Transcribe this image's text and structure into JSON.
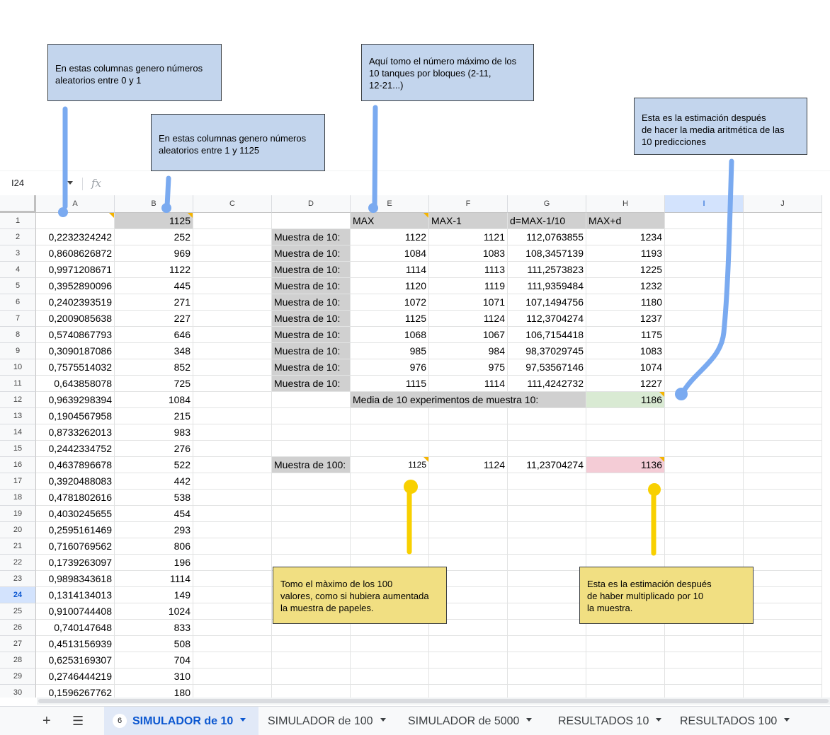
{
  "formula_bar": {
    "cell_ref": "I24",
    "fx_symbol": "fx"
  },
  "columns": [
    "A",
    "B",
    "C",
    "D",
    "E",
    "F",
    "G",
    "H",
    "I",
    "J"
  ],
  "selected_column": "I",
  "selected_row": "24",
  "rows": [
    {
      "n": "1",
      "a": "",
      "b": "1125",
      "d": "",
      "e": "MAX",
      "f": "MAX-1",
      "g": "d=MAX-1/10",
      "h": "MAX+d"
    },
    {
      "n": "2",
      "a": "0,2232324242",
      "b": "252",
      "d": "Muestra de 10:",
      "e": "1122",
      "f": "1121",
      "g": "112,0763855",
      "h": "1234"
    },
    {
      "n": "3",
      "a": "0,8608626872",
      "b": "969",
      "d": "Muestra de 10:",
      "e": "1084",
      "f": "1083",
      "g": "108,3457139",
      "h": "1193"
    },
    {
      "n": "4",
      "a": "0,9971208671",
      "b": "1122",
      "d": "Muestra de 10:",
      "e": "1114",
      "f": "1113",
      "g": "111,2573823",
      "h": "1225"
    },
    {
      "n": "5",
      "a": "0,3952890096",
      "b": "445",
      "d": "Muestra de 10:",
      "e": "1120",
      "f": "1119",
      "g": "111,9359484",
      "h": "1232"
    },
    {
      "n": "6",
      "a": "0,2402393519",
      "b": "271",
      "d": "Muestra de 10:",
      "e": "1072",
      "f": "1071",
      "g": "107,1494756",
      "h": "1180"
    },
    {
      "n": "7",
      "a": "0,2009085638",
      "b": "227",
      "d": "Muestra de 10:",
      "e": "1125",
      "f": "1124",
      "g": "112,3704274",
      "h": "1237"
    },
    {
      "n": "8",
      "a": "0,5740867793",
      "b": "646",
      "d": "Muestra de 10:",
      "e": "1068",
      "f": "1067",
      "g": "106,7154418",
      "h": "1175"
    },
    {
      "n": "9",
      "a": "0,3090187086",
      "b": "348",
      "d": "Muestra de 10:",
      "e": "985",
      "f": "984",
      "g": "98,37029745",
      "h": "1083"
    },
    {
      "n": "10",
      "a": "0,7575514032",
      "b": "852",
      "d": "Muestra de 10:",
      "e": "976",
      "f": "975",
      "g": "97,53567146",
      "h": "1074"
    },
    {
      "n": "11",
      "a": "0,643858078",
      "b": "725",
      "d": "Muestra de 10:",
      "e": "1115",
      "f": "1114",
      "g": "111,4242732",
      "h": "1227"
    },
    {
      "n": "12",
      "a": "0,9639298394",
      "b": "1084",
      "d": "",
      "e": "Media de 10 experimentos de muestra 10:",
      "f": "",
      "g": "",
      "h": "1186"
    },
    {
      "n": "13",
      "a": "0,1904567958",
      "b": "215",
      "d": "",
      "e": "",
      "f": "",
      "g": "",
      "h": ""
    },
    {
      "n": "14",
      "a": "0,8733262013",
      "b": "983",
      "d": "",
      "e": "",
      "f": "",
      "g": "",
      "h": ""
    },
    {
      "n": "15",
      "a": "0,2442334752",
      "b": "276",
      "d": "",
      "e": "",
      "f": "",
      "g": "",
      "h": ""
    },
    {
      "n": "16",
      "a": "0,4637896678",
      "b": "522",
      "d": "Muestra de 100:",
      "e": "1125",
      "f": "1124",
      "g": "11,23704274",
      "h": "1136"
    },
    {
      "n": "17",
      "a": "0,3920488083",
      "b": "442"
    },
    {
      "n": "18",
      "a": "0,4781802616",
      "b": "538"
    },
    {
      "n": "19",
      "a": "0,4030245655",
      "b": "454"
    },
    {
      "n": "20",
      "a": "0,2595161469",
      "b": "293"
    },
    {
      "n": "21",
      "a": "0,7160769562",
      "b": "806"
    },
    {
      "n": "22",
      "a": "0,1739263097",
      "b": "196"
    },
    {
      "n": "23",
      "a": "0,9898343618",
      "b": "1114"
    },
    {
      "n": "24",
      "a": "0,1314134013",
      "b": "149"
    },
    {
      "n": "25",
      "a": "0,9100744408",
      "b": "1024"
    },
    {
      "n": "26",
      "a": "0,740147648",
      "b": "833"
    },
    {
      "n": "27",
      "a": "0,4513156939",
      "b": "508"
    },
    {
      "n": "28",
      "a": "0,6253169307",
      "b": "704"
    },
    {
      "n": "29",
      "a": "0,2746444219",
      "b": "310"
    },
    {
      "n": "30",
      "a": "0,1596267762",
      "b": "180"
    }
  ],
  "annotations": {
    "note_a": "En estas columnas genero números\naleatorios entre 0 y 1",
    "note_b": "En estas columnas genero números\naleatorios entre 1 y 1125",
    "note_e": "Aquí tomo el número máximo de los\n10 tanques por bloques (2-11,\n12-21...)",
    "note_h": "Esta es la estimación después\nde hacer la media aritmética de las\n10 predicciones",
    "note_e16": "Tomo el màximo de los 100\nvalores, como si hubiera aumentada\nla muestra de papeles.",
    "note_h16": "Esta es la estimación después\nde haber multiplicado por 10\nla muestra."
  },
  "colors": {
    "blue_note": "#c3d5ed",
    "yellow_note": "#f1df82",
    "blue_arrow": "#7aaaf0",
    "yellow_arrow": "#f8d000",
    "green_cell": "#d9ead3",
    "pink_cell": "#f4ccd6",
    "gray_cell": "#d0d0d0"
  },
  "tabs": [
    {
      "label": "SIMULADOR de 10",
      "badge": "6",
      "active": true
    },
    {
      "label": "SIMULADOR de 100",
      "active": false
    },
    {
      "label": "SIMULADOR de 5000",
      "active": false
    },
    {
      "label": "RESULTADOS 10",
      "active": false
    },
    {
      "label": "RESULTADOS 100",
      "active": false
    }
  ],
  "icons": {
    "add_sheet": "plus-icon",
    "all_sheets": "menu-icon"
  }
}
